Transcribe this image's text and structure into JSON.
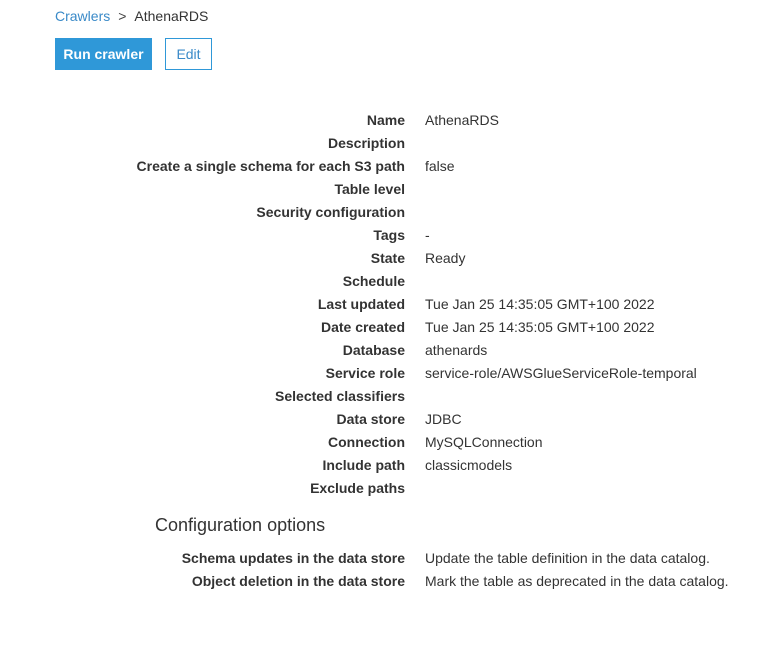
{
  "breadcrumb": {
    "parent": "Crawlers",
    "separator": ">",
    "current": "AthenaRDS"
  },
  "toolbar": {
    "run_label": "Run crawler",
    "edit_label": "Edit"
  },
  "details": [
    {
      "label": "Name",
      "value": "AthenaRDS"
    },
    {
      "label": "Description",
      "value": ""
    },
    {
      "label": "Create a single schema for each S3 path",
      "value": "false"
    },
    {
      "label": "Table level",
      "value": ""
    },
    {
      "label": "Security configuration",
      "value": ""
    },
    {
      "label": "Tags",
      "value": "-"
    },
    {
      "label": "State",
      "value": "Ready"
    },
    {
      "label": "Schedule",
      "value": ""
    },
    {
      "label": "Last updated",
      "value": "Tue Jan 25 14:35:05 GMT+100 2022"
    },
    {
      "label": "Date created",
      "value": "Tue Jan 25 14:35:05 GMT+100 2022"
    },
    {
      "label": "Database",
      "value": "athenards"
    },
    {
      "label": "Service role",
      "value": "service-role/AWSGlueServiceRole-temporal"
    },
    {
      "label": "Selected classifiers",
      "value": ""
    },
    {
      "label": "Data store",
      "value": "JDBC"
    },
    {
      "label": "Connection",
      "value": "MySQLConnection"
    },
    {
      "label": "Include path",
      "value": "classicmodels"
    },
    {
      "label": "Exclude paths",
      "value": ""
    }
  ],
  "config": {
    "title": "Configuration options",
    "items": [
      {
        "label": "Schema updates in the data store",
        "value": "Update the table definition in the data catalog."
      },
      {
        "label": "Object deletion in the data store",
        "value": "Mark the table as deprecated in the data catalog."
      }
    ]
  }
}
